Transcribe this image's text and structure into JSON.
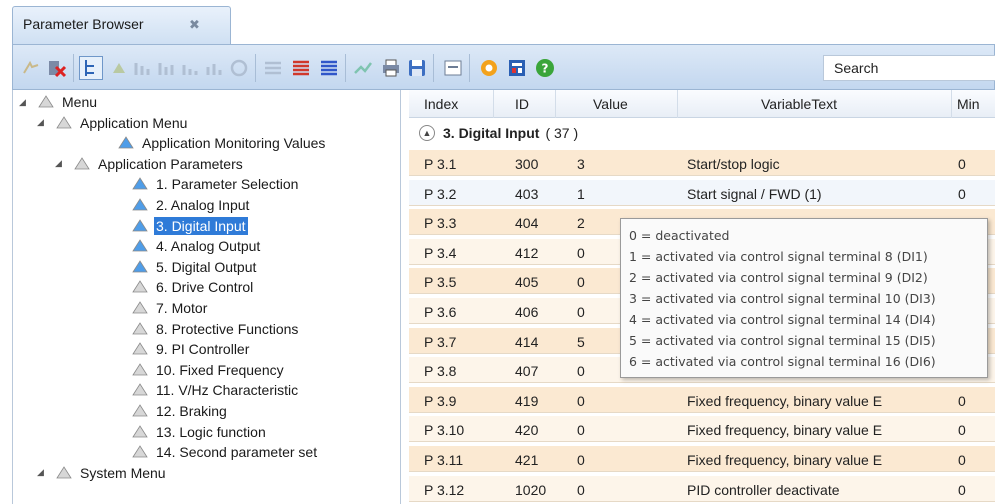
{
  "tab": {
    "title": "Parameter Browser",
    "close_glyph": "✖"
  },
  "toolbar": {
    "buttons": [
      "delete-icon",
      "tree-view-icon",
      "upload-icon",
      "download-icon",
      "compare-icon",
      "list-red-icon",
      "list-blue-icon",
      "chart-icon",
      "print-icon",
      "save-icon",
      "window-icon",
      "settings-icon",
      "calculator-icon",
      "help-icon"
    ],
    "search_value": "Search"
  },
  "tree": {
    "items": [
      {
        "label": "Menu",
        "level": 0,
        "expanded": true
      },
      {
        "label": "Application Menu",
        "level": 1,
        "expanded": true
      },
      {
        "label": "Application Monitoring Values",
        "level": 2
      },
      {
        "label": "Application Parameters",
        "level": 2,
        "expanded": true
      },
      {
        "label": "1. Parameter Selection",
        "level": 3
      },
      {
        "label": "2. Analog Input",
        "level": 3
      },
      {
        "label": "3. Digital Input",
        "level": 3,
        "selected": true
      },
      {
        "label": "4. Analog Output",
        "level": 3
      },
      {
        "label": "5. Digital Output",
        "level": 3
      },
      {
        "label": "6. Drive Control",
        "level": 3
      },
      {
        "label": "7. Motor",
        "level": 3
      },
      {
        "label": "8. Protective Functions",
        "level": 3
      },
      {
        "label": "9. PI Controller",
        "level": 3
      },
      {
        "label": "10. Fixed Frequency",
        "level": 3
      },
      {
        "label": "11. V/Hz Characteristic",
        "level": 3
      },
      {
        "label": "12. Braking",
        "level": 3
      },
      {
        "label": "13. Logic function",
        "level": 3
      },
      {
        "label": "14. Second parameter set",
        "level": 3
      },
      {
        "label": "System Menu",
        "level": 1,
        "expanded": true
      }
    ]
  },
  "grid": {
    "columns": [
      "Index",
      "ID",
      "Value",
      "VariableText",
      "Min"
    ],
    "group": {
      "title": "3. Digital Input",
      "count": "( 37 )"
    },
    "rows": [
      {
        "index": "P 3.1",
        "id": "300",
        "value": "3",
        "text": "Start/stop logic",
        "min": "0"
      },
      {
        "index": "P 3.2",
        "id": "403",
        "value": "1",
        "text": "Start signal / FWD (1)",
        "min": "0"
      },
      {
        "index": "P 3.3",
        "id": "404",
        "value": "2",
        "text": "",
        "min": ""
      },
      {
        "index": "P 3.4",
        "id": "412",
        "value": "0",
        "text": "",
        "min": ""
      },
      {
        "index": "P 3.5",
        "id": "405",
        "value": "0",
        "text": "",
        "min": ""
      },
      {
        "index": "P 3.6",
        "id": "406",
        "value": "0",
        "text": "",
        "min": ""
      },
      {
        "index": "P 3.7",
        "id": "414",
        "value": "5",
        "text": "",
        "min": ""
      },
      {
        "index": "P 3.8",
        "id": "407",
        "value": "0",
        "text": "",
        "min": ""
      },
      {
        "index": "P 3.9",
        "id": "419",
        "value": "0",
        "text": "Fixed frequency, binary value E",
        "min": "0"
      },
      {
        "index": "P 3.10",
        "id": "420",
        "value": "0",
        "text": "Fixed frequency, binary value E",
        "min": "0"
      },
      {
        "index": "P 3.11",
        "id": "421",
        "value": "0",
        "text": "Fixed frequency, binary value E",
        "min": "0"
      },
      {
        "index": "P 3.12",
        "id": "1020",
        "value": "0",
        "text": "PID controller deactivate",
        "min": "0"
      }
    ]
  },
  "tooltip": {
    "lines": [
      "0 = deactivated",
      "1 = activated via control signal terminal 8 (DI1)",
      "2 = activated via control signal terminal 9 (DI2)",
      "3 = activated via control signal terminal 10 (DI3)",
      "4 = activated via control signal terminal 14 (DI4)",
      "5 = activated via control signal terminal 15 (DI5)",
      "6 = activated via control signal terminal 16 (DI6)"
    ]
  },
  "colors": {
    "selection": "#2f7bd8",
    "row_odd": "#fbe9d2",
    "row_even": "#fdf5ea",
    "toolbar": "#c3d7ef"
  }
}
